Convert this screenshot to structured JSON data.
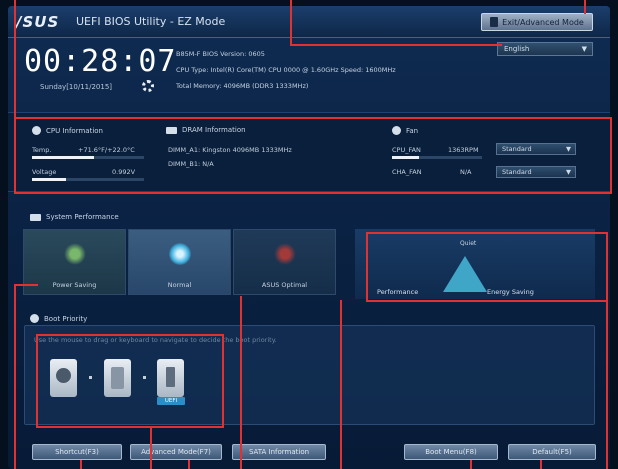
{
  "titlebar": {
    "logo": "/SUS",
    "title": "UEFI BIOS Utility - EZ Mode",
    "advanced_button": "Exit/Advanced Mode"
  },
  "system": {
    "time": "00:28:07",
    "date": "Sunday[10/11/2015]",
    "model_line": "B85M-F   BIOS Version: 0605",
    "cpu_line": "CPU Type: Intel(R) Core(TM) CPU 0000 @ 1.60GHz   Speed: 1600MHz",
    "memory_line": "Total Memory: 4096MB (DDR3 1333MHz)",
    "language": "English"
  },
  "cpu": {
    "heading": "CPU Information",
    "temp_label": "Temp.",
    "temp_value": "+71.6°F/+22.0°C",
    "voltage_label": "Voltage",
    "voltage_value": "0.992V",
    "temp_level": 0.55,
    "voltage_level": 0.3
  },
  "dram": {
    "heading": "DRAM Information",
    "slot_a1": "DIMM_A1: Kingston 4096MB 1333MHz",
    "slot_b1": "DIMM_B1: N/A"
  },
  "fan": {
    "heading": "Fan",
    "cpu_fan_label": "CPU_FAN",
    "cpu_fan_value": "1363RPM",
    "cpu_fan_level": 0.3,
    "chassis_fan_label": "CHA_FAN",
    "chassis_fan_value": "N/A",
    "cpu_fan_mode": "Standard",
    "chassis_fan_mode": "Standard"
  },
  "performance": {
    "heading": "System Performance",
    "mode_power_saving": "Power Saving",
    "mode_normal": "Normal",
    "mode_asus_optimal": "ASUS Optimal",
    "quiet_label": "Quiet",
    "performance_label": "Performance",
    "energy_label": "Energy Saving"
  },
  "boot": {
    "heading": "Boot Priority",
    "hint": "Use the mouse to drag or keyboard to navigate to decide the boot priority.",
    "usb_badge": "UEFI"
  },
  "buttons": {
    "shortcut": "Shortcut(F3)",
    "advanced_mode": "Advanced Mode(F7)",
    "sata_information": "SATA Information",
    "boot_menu": "Boot Menu(F8)",
    "default": "Default(F5)"
  },
  "colors": {
    "accent_red": "#e23131",
    "panel_blue": "#0b2345"
  }
}
